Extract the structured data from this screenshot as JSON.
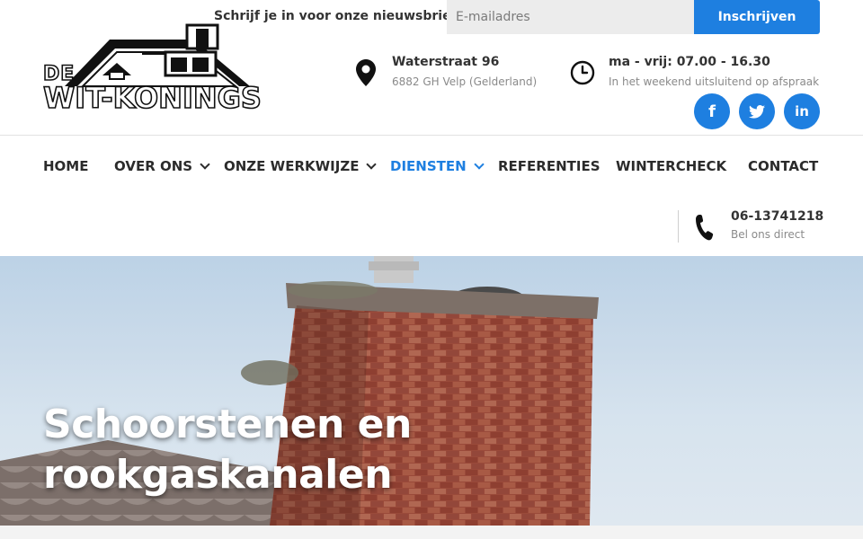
{
  "brand": {
    "logo_top": "DE",
    "logo_main": "WIT-KONINGS"
  },
  "newsletter": {
    "label": "Schrijf je in voor onze nieuwsbrief",
    "email_placeholder": "E-mailadres",
    "email_value": "",
    "submit_label": "Inschrijven"
  },
  "address": {
    "street": "Waterstraat 96",
    "city": "6882 GH Velp  (Gelderland)"
  },
  "hours": {
    "main": "ma - vrij: 07.00 - 16.30",
    "sub": "In het weekend uitsluitend op afspraak"
  },
  "social": {
    "facebook": "f",
    "twitter": "t",
    "linkedin": "in"
  },
  "nav": {
    "items": [
      {
        "label": "Home"
      },
      {
        "label": "Over ons"
      },
      {
        "label": "Onze werkwijze"
      },
      {
        "label": "Diensten"
      },
      {
        "label": "Referenties"
      },
      {
        "label": "Wintercheck"
      },
      {
        "label": "Contact"
      }
    ],
    "active": "Diensten"
  },
  "phone": {
    "number": "06-13741218",
    "sub": "Bel ons direct"
  },
  "hero": {
    "title": "Schoorstenen en rookgaskanalen"
  },
  "colors": {
    "accent": "#1e7fe0",
    "text": "#2b2b2b",
    "muted": "#8a8a8a"
  },
  "icons": [
    "map-marker-icon",
    "clock-icon",
    "facebook-icon",
    "twitter-icon",
    "linkedin-icon",
    "phone-icon",
    "chevron-down-icon"
  ]
}
